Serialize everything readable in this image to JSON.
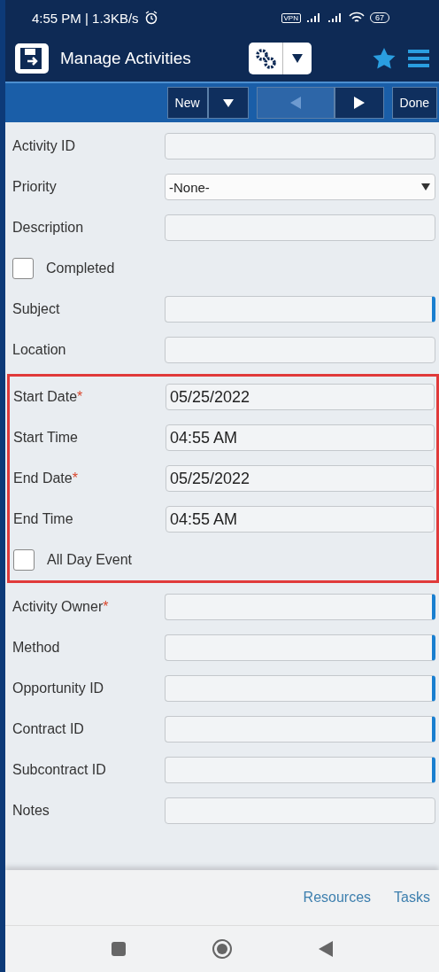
{
  "status_bar": {
    "time": "4:55 PM | 1.3KB/s",
    "vpn": "VPN",
    "battery": "67"
  },
  "header": {
    "title": "Manage Activities"
  },
  "toolbar": [
    {
      "kind": "text",
      "label": "New",
      "disabled": false
    },
    {
      "kind": "caret",
      "disabled": false
    },
    {
      "kind": "prev",
      "disabled": true
    },
    {
      "kind": "next",
      "disabled": false
    },
    {
      "kind": "text",
      "label": "Done",
      "disabled": false
    }
  ],
  "sections": [
    {
      "highlighted": false,
      "fields": [
        {
          "kind": "text",
          "label": "Activity ID",
          "lookup": false
        },
        {
          "kind": "select",
          "label": "Priority",
          "value": "-None-",
          "lookup": false
        },
        {
          "kind": "text",
          "label": "Description",
          "lookup": false
        },
        {
          "kind": "checkbox",
          "label": "Completed",
          "checked": false
        },
        {
          "kind": "text",
          "label": "Subject",
          "lookup": true
        },
        {
          "kind": "text",
          "label": "Location",
          "lookup": false
        }
      ]
    },
    {
      "highlighted": true,
      "fields": [
        {
          "kind": "text",
          "label": "Start Date",
          "required_mark": "*",
          "value": "05/25/2022",
          "lookup": false
        },
        {
          "kind": "text",
          "label": "Start Time",
          "value": "04:55 AM",
          "lookup": false
        },
        {
          "kind": "text",
          "label": "End Date",
          "required_mark": "*",
          "value": "05/25/2022",
          "lookup": false
        },
        {
          "kind": "text",
          "label": "End Time",
          "value": "04:55 AM",
          "lookup": false
        },
        {
          "kind": "checkbox",
          "label": "All Day Event",
          "checked": false
        }
      ]
    },
    {
      "highlighted": false,
      "fields": [
        {
          "kind": "text",
          "label": "Activity Owner",
          "required_mark": "*",
          "lookup": true
        },
        {
          "kind": "text",
          "label": "Method",
          "lookup": true
        },
        {
          "kind": "text",
          "label": "Opportunity ID",
          "lookup": true
        },
        {
          "kind": "text",
          "label": "Contract ID",
          "lookup": true
        },
        {
          "kind": "text",
          "label": "Subcontract ID",
          "lookup": true
        },
        {
          "kind": "text",
          "label": "Notes",
          "lookup": false
        }
      ]
    }
  ],
  "footer_links": [
    "Resources",
    "Tasks"
  ]
}
